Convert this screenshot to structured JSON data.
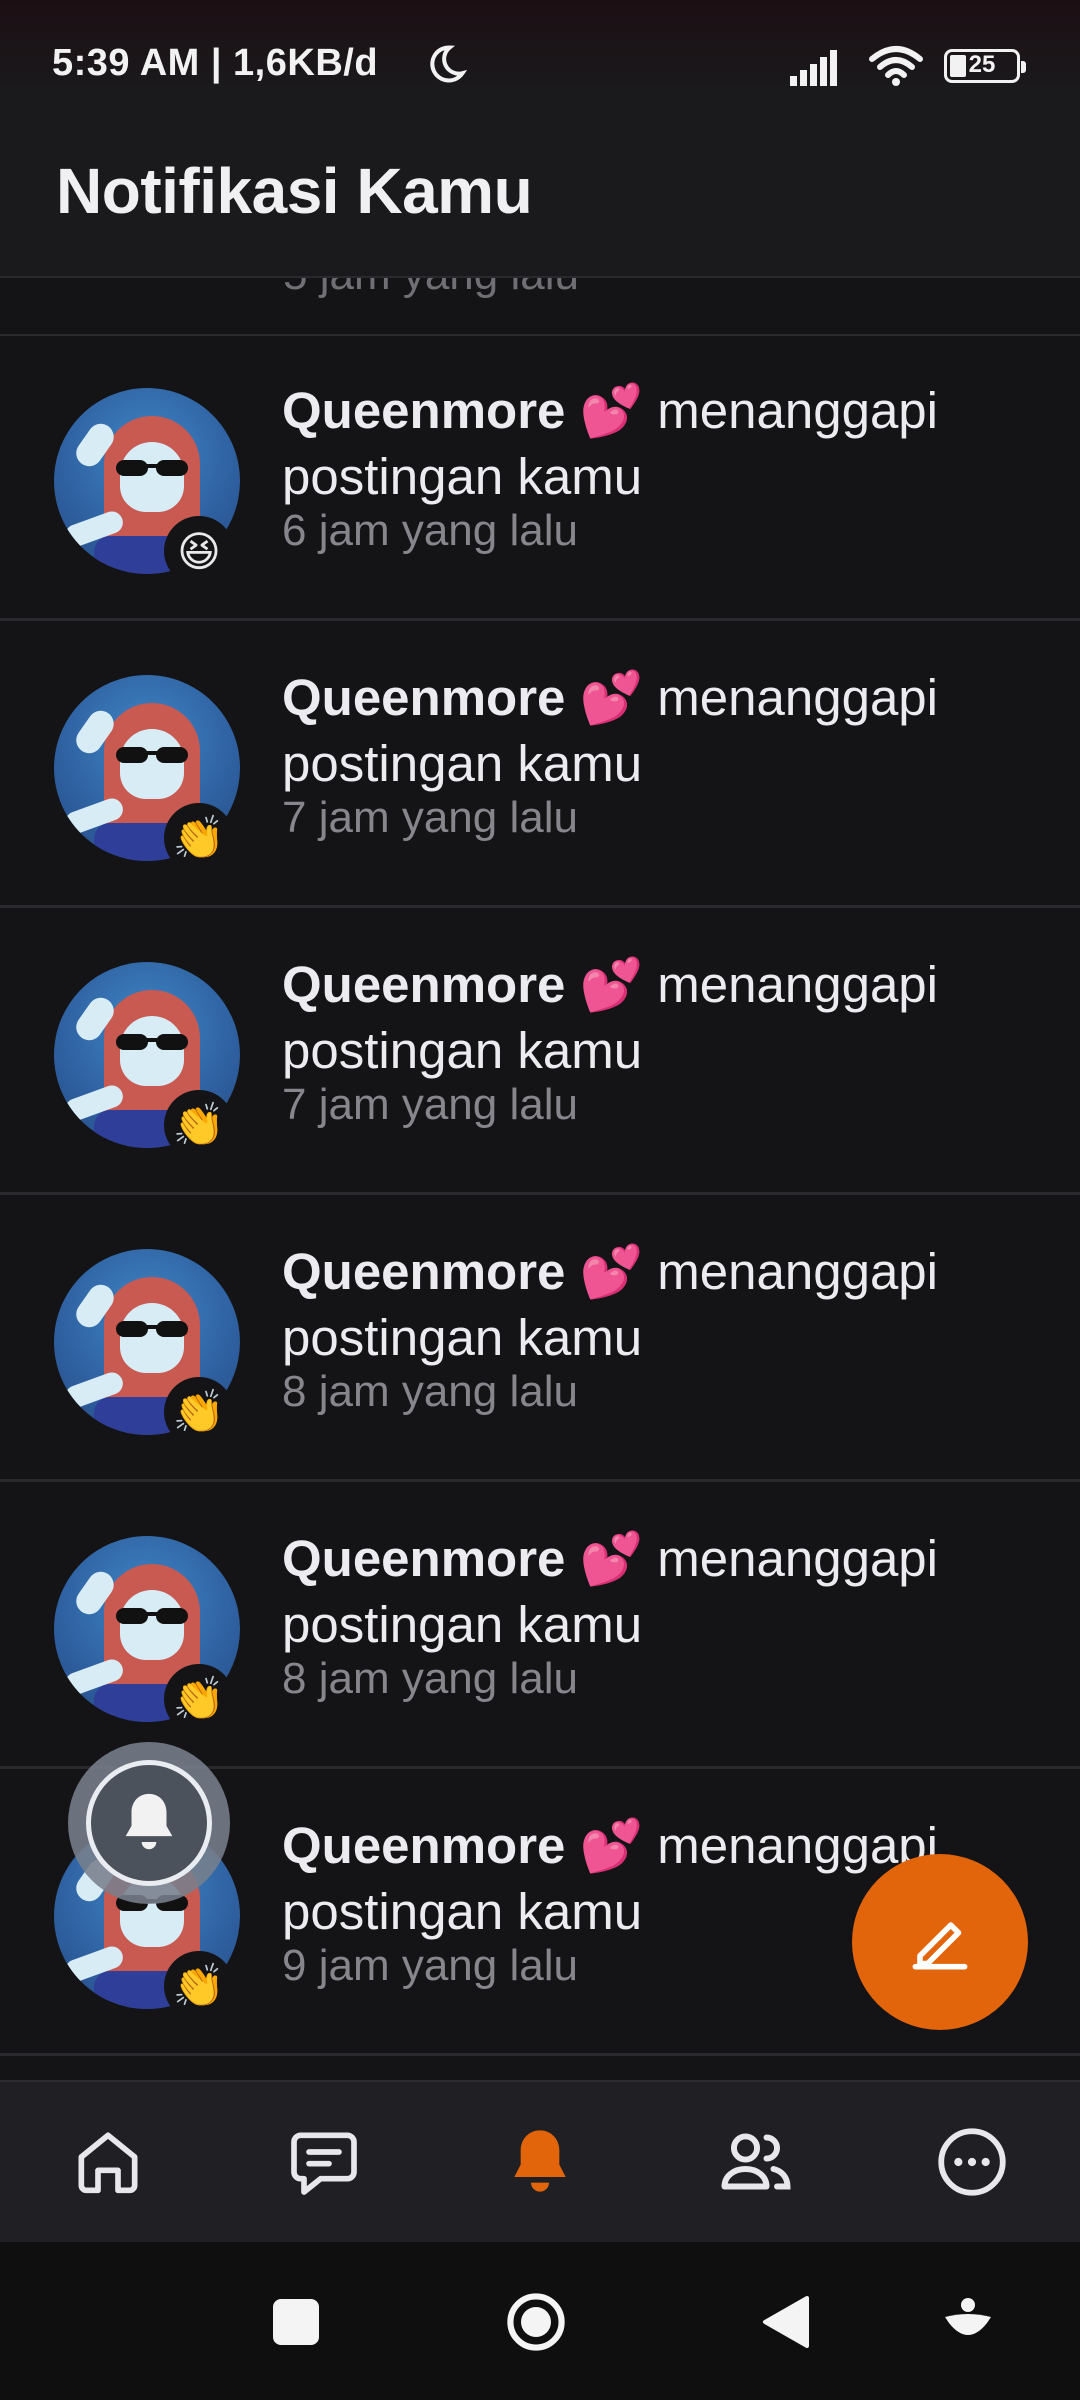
{
  "status_bar": {
    "time": "5:39 AM | 1,6KB/d",
    "battery_level": "25"
  },
  "header": {
    "title": "Notifikasi Kamu"
  },
  "partial_row": {
    "time": "5 jam yang lalu"
  },
  "notifications": [
    {
      "username": "Queenmore",
      "emoji": "💕",
      "action": " menanggapi postingan kamu",
      "time": "6 jam yang lalu",
      "reaction": "😆"
    },
    {
      "username": "Queenmore",
      "emoji": "💕",
      "action": " menanggapi postingan kamu",
      "time": "7 jam yang lalu",
      "reaction": "👏"
    },
    {
      "username": "Queenmore",
      "emoji": "💕",
      "action": " menanggapi postingan kamu",
      "time": "7 jam yang lalu",
      "reaction": "👏"
    },
    {
      "username": "Queenmore",
      "emoji": "💕",
      "action": " menanggapi postingan kamu",
      "time": "8 jam yang lalu",
      "reaction": "👏"
    },
    {
      "username": "Queenmore",
      "emoji": "💕",
      "action": " menanggapi postingan kamu",
      "time": "8 jam yang lalu",
      "reaction": "👏"
    },
    {
      "username": "Queenmore",
      "emoji": "💕",
      "action": " menanggapi postingan kamu",
      "time": "9 jam yang lalu",
      "reaction": "👏"
    }
  ],
  "bottom_nav": {
    "items": [
      {
        "icon": "home-icon",
        "active": false
      },
      {
        "icon": "chat-icon",
        "active": false
      },
      {
        "icon": "bell-icon",
        "active": true
      },
      {
        "icon": "friends-icon",
        "active": false
      },
      {
        "icon": "more-icon",
        "active": false
      }
    ]
  },
  "colors": {
    "accent": "#e3650b",
    "background": "#141416",
    "text_secondary": "#86868c"
  }
}
